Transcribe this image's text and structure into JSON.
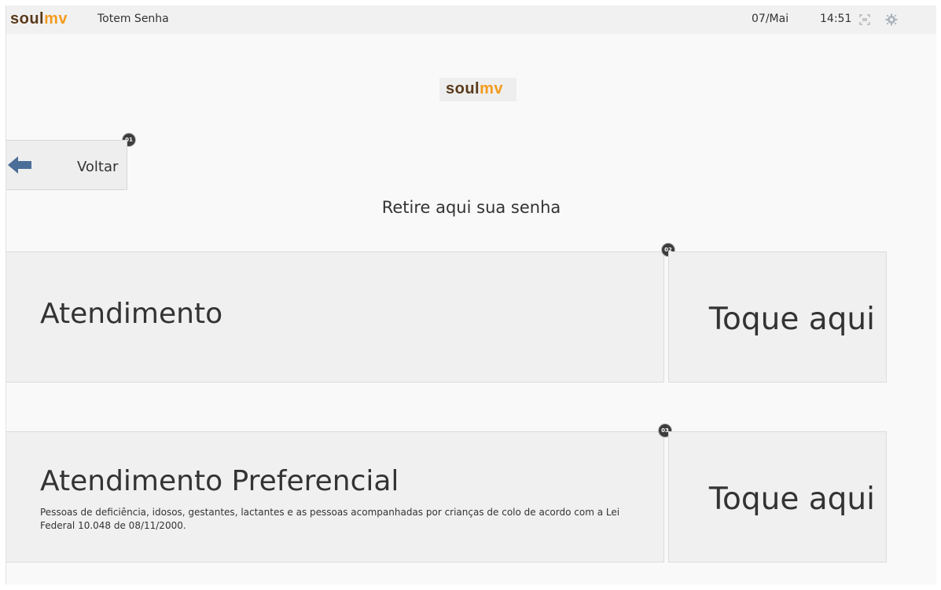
{
  "header": {
    "brand_soul": "soul",
    "brand_mv": "mv",
    "title": "Totem Senha",
    "date": "07/Mai",
    "time": "14:51",
    "icons": [
      "fullscreen-icon",
      "gear-icon"
    ]
  },
  "logo": {
    "soul": "soul",
    "mv": "mv"
  },
  "back": {
    "badge": "01",
    "label": "Voltar"
  },
  "subtitle": "Retire aqui sua senha",
  "options": [
    {
      "badge": "02",
      "title": "Atendimento",
      "description": "",
      "action": "Toque aqui"
    },
    {
      "badge": "03",
      "title": "Atendimento Preferencial",
      "description": "Pessoas de deficiência, idosos, gestantes, lactantes e as pessoas acompanhadas por crianças de colo de acordo com a Lei Federal 10.048 de 08/11/2000.",
      "action": "Toque aqui"
    }
  ],
  "colors": {
    "brand_brown": "#5a3a1a",
    "brand_orange": "#f39a1e",
    "arrow_blue": "#4a6e97",
    "badge": "#3d3d3d"
  }
}
